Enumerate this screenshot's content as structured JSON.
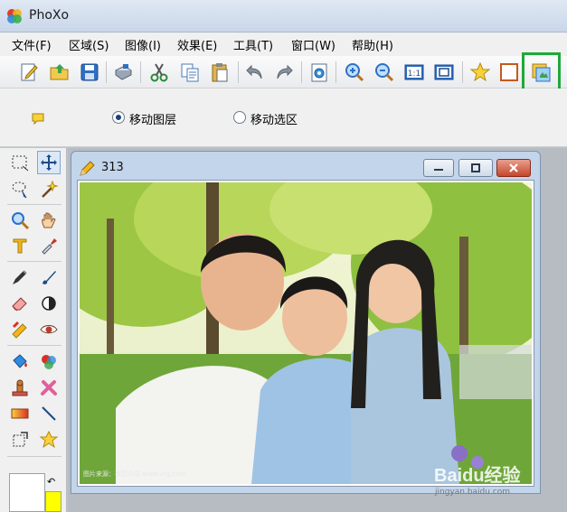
{
  "window": {
    "title": "PhoXo"
  },
  "menu": [
    "文件(F)",
    "区域(S)",
    "图像(I)",
    "效果(E)",
    "工具(T)",
    "窗口(W)",
    "帮助(H)"
  ],
  "toolbar": {
    "items": [
      "new-icon",
      "open-icon",
      "save-icon",
      "print-icon",
      "cut-icon",
      "copy-icon",
      "paste-icon",
      "undo-icon",
      "redo-icon",
      "settings-icon",
      "zoom-in-icon",
      "zoom-out-icon",
      "actual-size-icon",
      "fit-window-icon",
      "favorite-icon",
      "frame-icon",
      "layer-icon"
    ],
    "actual_size_label": "1:1"
  },
  "options": {
    "move_layer_label": "移动图层",
    "move_selection_label": "移动选区",
    "selected": "move_layer"
  },
  "document": {
    "title": "313"
  },
  "photo": {
    "credit": "图片来源：视觉中国 www.vcg.com",
    "watermark": "Baidu经验",
    "watermark_url": "jingyan.baidu.com"
  },
  "colors": {
    "highlight": "#1fa83a",
    "foreground": "#ffff00",
    "background": "#ffffff"
  }
}
